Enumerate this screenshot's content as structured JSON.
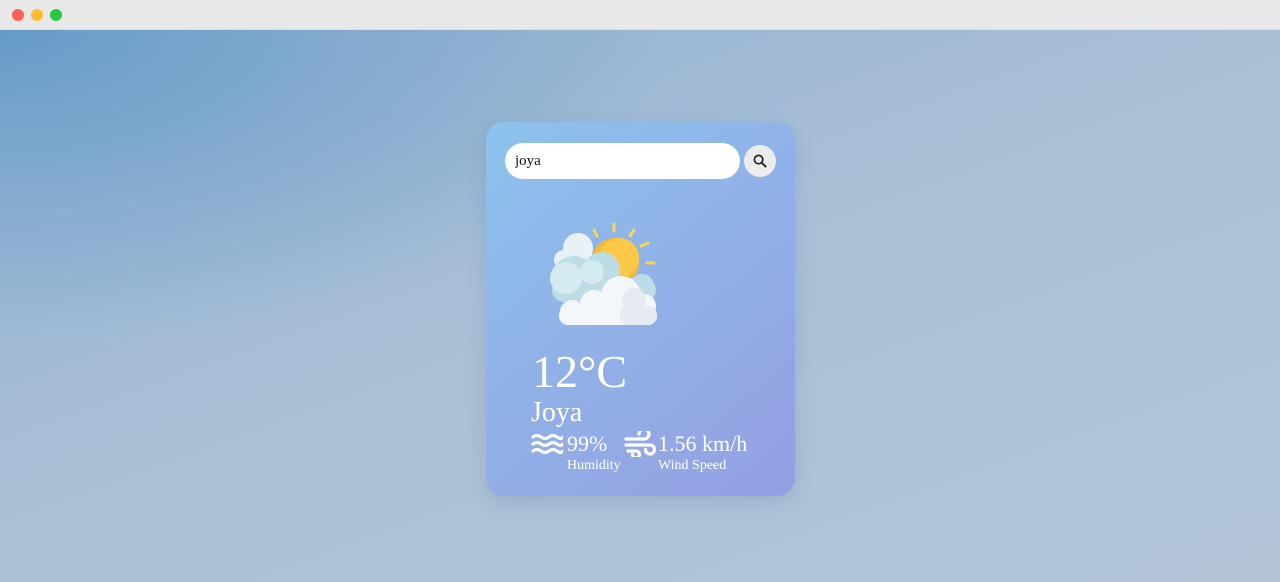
{
  "search": {
    "value": "joya"
  },
  "weather": {
    "icon": "sun-behind-clouds-icon",
    "temperature": "12°C",
    "city": "Joya",
    "humidity": {
      "value": "99%",
      "label": "Humidity",
      "icon": "humidity-waves-icon"
    },
    "wind": {
      "value": "1.56 km/h",
      "label": "Wind Speed",
      "icon": "wind-icon"
    }
  },
  "colors": {
    "card_gradient_start": "#8cc3ec",
    "card_gradient_end": "#959fe2",
    "sun": "#fbbf24",
    "text": "#ffffff"
  }
}
